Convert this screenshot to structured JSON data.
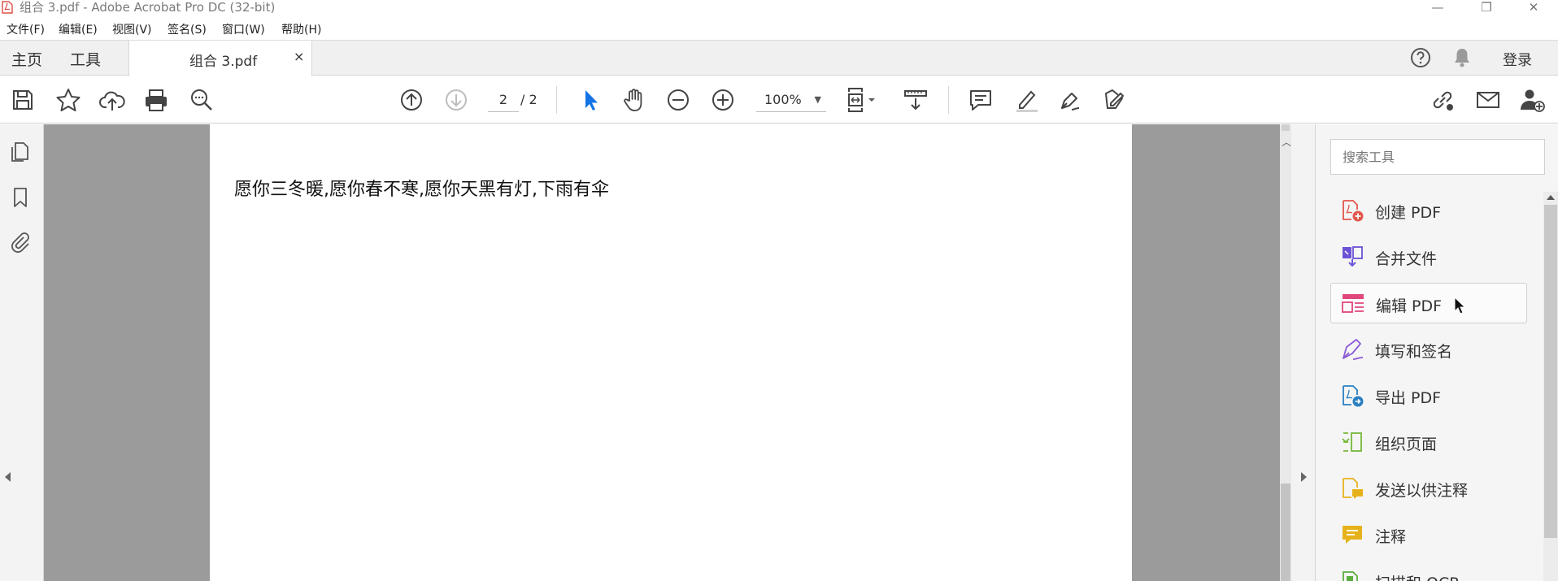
{
  "window": {
    "title": "组合 3.pdf - Adobe Acrobat Pro DC (32-bit)",
    "minimize": "—",
    "maximize": "❐",
    "close": "✕"
  },
  "menu": {
    "items": [
      "文件(F)",
      "编辑(E)",
      "视图(V)",
      "签名(S)",
      "窗口(W)",
      "帮助(H)"
    ]
  },
  "tabs": {
    "home": "主页",
    "tools": "工具",
    "document": "组合 3.pdf",
    "close": "×",
    "login": "登录"
  },
  "toolbar": {
    "page_current": "2",
    "page_total": "/ 2",
    "zoom": "100%"
  },
  "document": {
    "text": "愿你三冬暖,愿你春不寒,愿你天黑有灯,下雨有伞"
  },
  "right_pane": {
    "search_placeholder": "搜索工具",
    "tools": [
      {
        "label": "创建 PDF",
        "color": "#e2574c"
      },
      {
        "label": "合并文件",
        "color": "#6c53d6"
      },
      {
        "label": "编辑 PDF",
        "color": "#e0467c"
      },
      {
        "label": "填写和签名",
        "color": "#8a5ad6"
      },
      {
        "label": "导出 PDF",
        "color": "#2b7fc1"
      },
      {
        "label": "组织页面",
        "color": "#76b83c"
      },
      {
        "label": "发送以供注释",
        "color": "#e6b21c"
      },
      {
        "label": "注释",
        "color": "#e6b21c"
      },
      {
        "label": "扫描和 OCR",
        "color": "#5aae3c"
      }
    ]
  },
  "colors": {
    "accent": "#1473e6",
    "doc_background": "#9b9b9b"
  }
}
